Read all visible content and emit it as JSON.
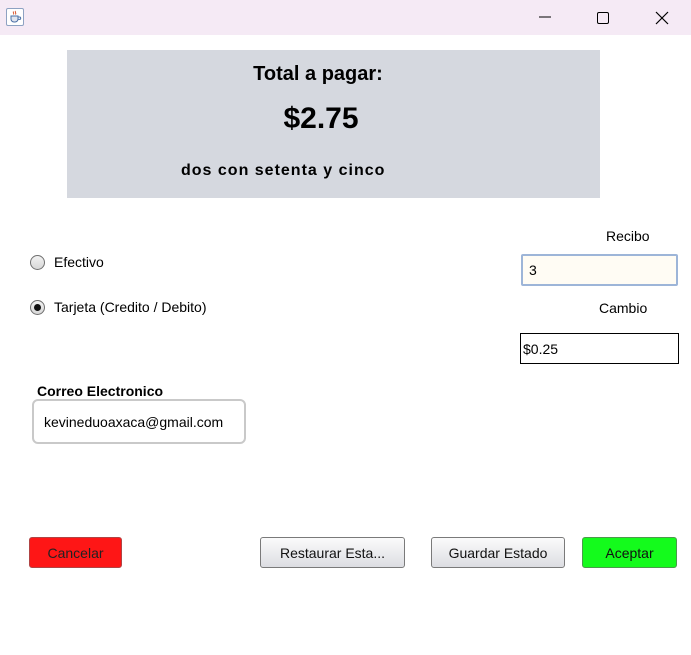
{
  "window": {
    "icon": "java-coffee-icon",
    "controls": [
      "minimize-icon",
      "maximize-icon",
      "close-icon"
    ]
  },
  "summary": {
    "title": "Total a pagar:",
    "amount": "$2.75",
    "amount_words": "dos con setenta y cinco",
    "panel_color": "#d5d8df"
  },
  "payment_methods": {
    "efectivo": {
      "label": "Efectivo",
      "selected": false
    },
    "tarjeta": {
      "label": "Tarjeta (Credito / Debito)",
      "selected": true
    }
  },
  "recibo": {
    "label": "Recibo",
    "value": "3"
  },
  "cambio": {
    "label": "Cambio",
    "value": "$0.25"
  },
  "email": {
    "label": "Correo Electronico",
    "value": "kevineduoaxaca@gmail.com"
  },
  "buttons": {
    "cancelar": {
      "label": "Cancelar",
      "color": "#fe1616"
    },
    "restaurar": {
      "label": "Restaurar Esta..."
    },
    "guardar": {
      "label": "Guardar Estado"
    },
    "aceptar": {
      "label": "Aceptar",
      "color": "#14fb1c"
    }
  }
}
